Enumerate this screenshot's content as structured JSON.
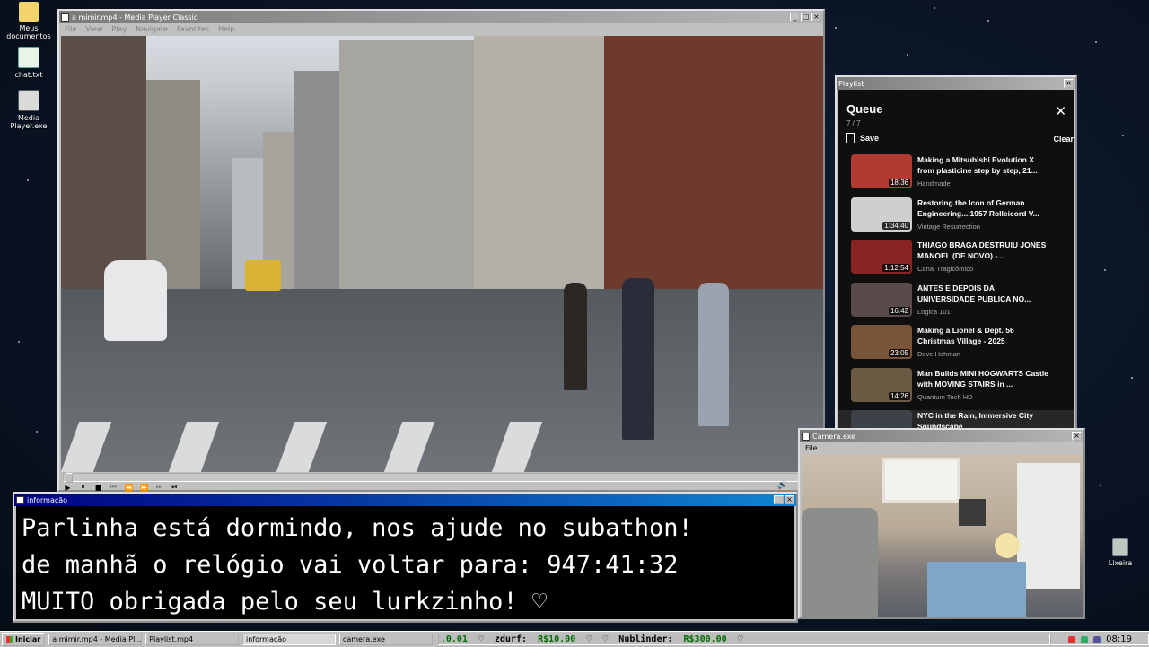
{
  "desktop": {
    "icons": [
      {
        "label": "Meus documentos"
      },
      {
        "label": "chat.txt"
      },
      {
        "label": "Media Player.exe"
      },
      {
        "label": "Lixeira"
      }
    ]
  },
  "player": {
    "title": "a mimir.mp4 - Media Player Classic",
    "menu": [
      "File",
      "View",
      "Play",
      "Navigate",
      "Favorites",
      "Help"
    ]
  },
  "playlist": {
    "title": "Playlist",
    "heading": "Queue",
    "count": "7 / 7",
    "save_label": "Save",
    "clear_label": "Clear",
    "items": [
      {
        "title": "Making a Mitsubishi Evolution X from plasticine step by step, 21...",
        "channel": "Handmade",
        "duration": "18:36",
        "thumb_color": "#b23a32"
      },
      {
        "title": "Restoring the Icon of German Engineering....1957 Rolleicord V...",
        "channel": "Vintage Resurrection",
        "duration": "1:34:40",
        "thumb_color": "#cfcfcf"
      },
      {
        "title": "THIAGO BRAGA DESTRUIU JONES MANOEL (DE NOVO) -...",
        "channel": "Canal Tragicômico",
        "duration": "1:12:54",
        "thumb_color": "#8a2424"
      },
      {
        "title": "ANTES E DEPOIS DA UNIVERSIDADE PUBLICA NO...",
        "channel": "Logica 101",
        "duration": "16:42",
        "thumb_color": "#5a4a4a"
      },
      {
        "title": "Making a Lionel & Dept. 56 Christmas Village - 2025",
        "channel": "Dave Hohman",
        "duration": "23:05",
        "thumb_color": "#7a5438"
      },
      {
        "title": "Man Builds MINI HOGWARTS Castle with MOVING STAIRS in ...",
        "channel": "Quantum Tech HD",
        "duration": "14:26",
        "thumb_color": "#6b5a44"
      },
      {
        "title": "NYC in the Rain, Immersive City Soundscape",
        "channel": "",
        "duration": "",
        "thumb_color": "#3d4148"
      }
    ]
  },
  "info": {
    "title": "informação",
    "lines": [
      "Parlinha está dormindo, nos ajude no subathon!",
      "de manhã o relógio vai voltar para:  947:41:32",
      "MUITO obrigada pelo seu lurkzinho! ♡"
    ]
  },
  "camera": {
    "title": "Camera.exe",
    "menu_file": "File"
  },
  "taskbar": {
    "start": "Iniciar",
    "tasks": [
      "a mimir.mp4 - Media Pl...",
      "Playlist.mp4",
      "informação",
      "camera.exe"
    ],
    "ticker": {
      "lead": ".0.01",
      "items": [
        {
          "name": "zdurf:",
          "amount": "R$10.00"
        },
        {
          "name": "Nublinder:",
          "amount": "R$300.00"
        }
      ]
    },
    "clock": "08:19"
  }
}
